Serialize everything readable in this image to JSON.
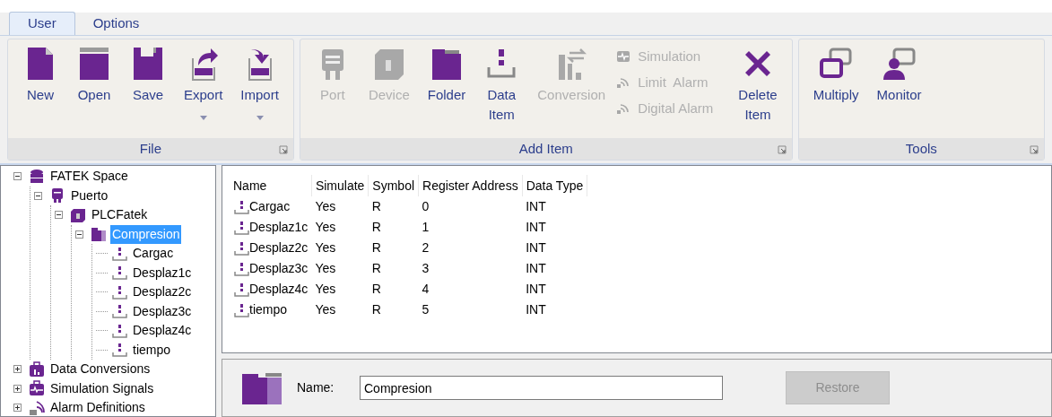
{
  "tabs": [
    {
      "label": "User",
      "selected": true
    },
    {
      "label": "Options",
      "selected": false
    }
  ],
  "ribbon": {
    "groups": [
      {
        "title": "File",
        "large": [
          {
            "label": "New",
            "disabled": false,
            "dropdown": false
          },
          {
            "label": "Open",
            "disabled": false,
            "dropdown": false
          },
          {
            "label": "Save",
            "disabled": false,
            "dropdown": false
          },
          {
            "label": "Export",
            "disabled": false,
            "dropdown": true
          },
          {
            "label": "Import",
            "disabled": false,
            "dropdown": true
          }
        ]
      },
      {
        "title": "Add Item",
        "large": [
          {
            "label": "Port",
            "disabled": true,
            "dropdown": false
          },
          {
            "label": "Device",
            "disabled": true,
            "dropdown": false
          },
          {
            "label": "Folder",
            "disabled": false,
            "dropdown": false
          },
          {
            "label": "Data\nItem",
            "disabled": false,
            "dropdown": false
          },
          {
            "label": "Conversion",
            "disabled": true,
            "dropdown": false
          }
        ],
        "small": [
          {
            "label": "Simulation",
            "disabled": true
          },
          {
            "label": "Limit  Alarm",
            "disabled": true
          },
          {
            "label": "Digital Alarm",
            "disabled": true
          }
        ],
        "trailing": [
          {
            "label": "Delete\nItem",
            "disabled": false,
            "dropdown": false
          }
        ]
      },
      {
        "title": "Tools",
        "large": [
          {
            "label": "Multiply",
            "disabled": false,
            "dropdown": false
          },
          {
            "label": "Monitor",
            "disabled": false,
            "dropdown": false
          }
        ]
      }
    ]
  },
  "tree": [
    {
      "kind": "space",
      "label": "FATEK Space",
      "expanded": true,
      "selected": false,
      "children": [
        {
          "kind": "port",
          "label": "Puerto",
          "expanded": true,
          "selected": false,
          "children": [
            {
              "kind": "device",
              "label": "PLCFatek",
              "expanded": true,
              "selected": false,
              "children": [
                {
                  "kind": "folder",
                  "label": "Compresion",
                  "expanded": true,
                  "selected": true,
                  "children": [
                    {
                      "kind": "item",
                      "label": "Cargac",
                      "selected": false
                    },
                    {
                      "kind": "item",
                      "label": "Desplaz1c",
                      "selected": false
                    },
                    {
                      "kind": "item",
                      "label": "Desplaz2c",
                      "selected": false
                    },
                    {
                      "kind": "item",
                      "label": "Desplaz3c",
                      "selected": false
                    },
                    {
                      "kind": "item",
                      "label": "Desplaz4c",
                      "selected": false
                    },
                    {
                      "kind": "item",
                      "label": "tiempo",
                      "selected": false
                    }
                  ]
                }
              ]
            }
          ]
        }
      ]
    },
    {
      "kind": "conversions",
      "label": "Data Conversions",
      "expanded": false,
      "selected": false
    },
    {
      "kind": "simulation",
      "label": "Simulation Signals",
      "expanded": false,
      "selected": false
    },
    {
      "kind": "alarms",
      "label": "Alarm Definitions",
      "expanded": false,
      "selected": false
    }
  ],
  "table": {
    "columns": [
      "Name",
      "Simulate",
      "Symbol",
      "Register Address",
      "Data Type"
    ],
    "rows": [
      [
        "Cargac",
        "Yes",
        "R",
        "0",
        "INT"
      ],
      [
        "Desplaz1c",
        "Yes",
        "R",
        "1",
        "INT"
      ],
      [
        "Desplaz2c",
        "Yes",
        "R",
        "2",
        "INT"
      ],
      [
        "Desplaz3c",
        "Yes",
        "R",
        "3",
        "INT"
      ],
      [
        "Desplaz4c",
        "Yes",
        "R",
        "4",
        "INT"
      ],
      [
        "tiempo",
        "Yes",
        "R",
        "5",
        "INT"
      ]
    ]
  },
  "details": {
    "name_label": "Name:",
    "name_value": "Compresion",
    "restore": {
      "label": "Restore",
      "disabled": true
    }
  }
}
